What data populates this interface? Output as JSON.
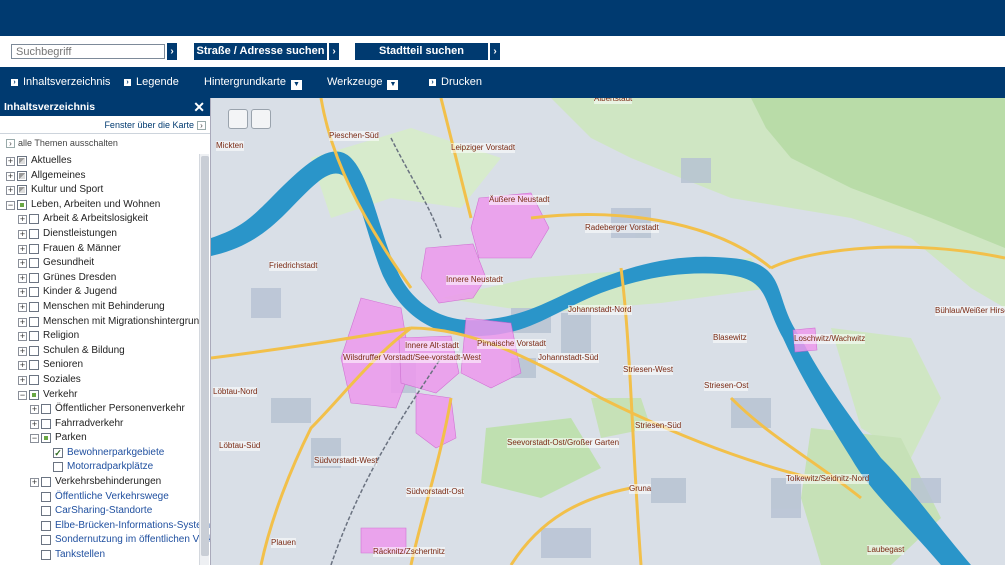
{
  "search": {
    "placeholder": "Suchbegriff",
    "street_button": "Straße / Adresse suchen",
    "district_button": "Stadtteil suchen",
    "arrow": "›"
  },
  "menu": {
    "items": [
      "Inhaltsverzeichnis",
      "Legende",
      "Hintergrundkarte",
      "Werkzeuge",
      "Drucken"
    ]
  },
  "sidebar": {
    "title": "Inhaltsverzeichnis",
    "close": "✕",
    "window_over_map": "Fenster über die Karte",
    "all_themes_off": "alle Themen ausschalten",
    "tree": [
      {
        "label": "Aktuelles",
        "level": 0,
        "exp": "+",
        "chk": "grey"
      },
      {
        "label": "Allgemeines",
        "level": 0,
        "exp": "+",
        "chk": "grey"
      },
      {
        "label": "Kultur und Sport",
        "level": 0,
        "exp": "+",
        "chk": "grey"
      },
      {
        "label": "Leben, Arbeiten und Wohnen",
        "level": 0,
        "exp": "−",
        "chk": "partial"
      },
      {
        "label": "Arbeit & Arbeitslosigkeit",
        "level": 1,
        "exp": "+",
        "chk": ""
      },
      {
        "label": "Dienstleistungen",
        "level": 1,
        "exp": "+",
        "chk": ""
      },
      {
        "label": "Frauen & Männer",
        "level": 1,
        "exp": "+",
        "chk": ""
      },
      {
        "label": "Gesundheit",
        "level": 1,
        "exp": "+",
        "chk": ""
      },
      {
        "label": "Grünes Dresden",
        "level": 1,
        "exp": "+",
        "chk": ""
      },
      {
        "label": "Kinder & Jugend",
        "level": 1,
        "exp": "+",
        "chk": ""
      },
      {
        "label": "Menschen mit Behinderung",
        "level": 1,
        "exp": "+",
        "chk": ""
      },
      {
        "label": "Menschen mit Migrationshintergrund",
        "level": 1,
        "exp": "+",
        "chk": ""
      },
      {
        "label": "Religion",
        "level": 1,
        "exp": "+",
        "chk": ""
      },
      {
        "label": "Schulen & Bildung",
        "level": 1,
        "exp": "+",
        "chk": ""
      },
      {
        "label": "Senioren",
        "level": 1,
        "exp": "+",
        "chk": ""
      },
      {
        "label": "Soziales",
        "level": 1,
        "exp": "+",
        "chk": ""
      },
      {
        "label": "Verkehr",
        "level": 1,
        "exp": "−",
        "chk": "partial"
      },
      {
        "label": "Öffentlicher Personenverkehr",
        "level": 2,
        "exp": "+",
        "chk": ""
      },
      {
        "label": "Fahrradverkehr",
        "level": 2,
        "exp": "+",
        "chk": ""
      },
      {
        "label": "Parken",
        "level": 2,
        "exp": "−",
        "chk": "partial"
      },
      {
        "label": "Bewohnerparkgebiete",
        "level": 3,
        "exp": "",
        "chk": "checked",
        "link": true
      },
      {
        "label": "Motorradparkplätze",
        "level": 3,
        "exp": "",
        "chk": "",
        "link": true
      },
      {
        "label": "Verkehrsbehinderungen",
        "level": 2,
        "exp": "+",
        "chk": ""
      },
      {
        "label": "Öffentliche Verkehrswege",
        "level": 2,
        "exp": "",
        "chk": "",
        "link": true
      },
      {
        "label": "CarSharing-Standorte",
        "level": 2,
        "exp": "",
        "chk": "",
        "link": true
      },
      {
        "label": "Elbe-Brücken-Informations-System",
        "level": 2,
        "exp": "",
        "chk": "",
        "link": true
      },
      {
        "label": "Sondernutzung im öffentlichen Verkehr",
        "level": 2,
        "exp": "",
        "chk": "",
        "link": true
      },
      {
        "label": "Tankstellen",
        "level": 2,
        "exp": "",
        "chk": "",
        "link": true
      }
    ]
  },
  "map": {
    "labels": [
      "Albertstadt",
      "Pieschen-Süd",
      "Leipziger Vorstadt",
      "Mickten",
      "Äußere Neustadt",
      "Radeberger Vorstadt",
      "Friedrichstadt",
      "Innere Neustadt",
      "Johannstadt-Nord",
      "Wilsdruffer Vorstadt/See-vorstadt-West",
      "Innere Alt-stadt",
      "Pirnaische Vorstadt",
      "Johannstadt-Süd",
      "Blasewitz",
      "Loschwitz/Wachwitz",
      "Bühlau/Weißer Hirsch",
      "Löbtau-Nord",
      "Striesen-West",
      "Striesen-Ost",
      "Löbtau-Süd",
      "Striesen-Süd",
      "Seevorstadt-Ost/Großer Garten",
      "Südvorstadt-West",
      "Tolkewitz/Seidnitz-Nord",
      "Gruna",
      "Südvorstadt-Ost",
      "Plauen",
      "Räcknitz/Zschertnitz",
      "Laubegast"
    ]
  }
}
